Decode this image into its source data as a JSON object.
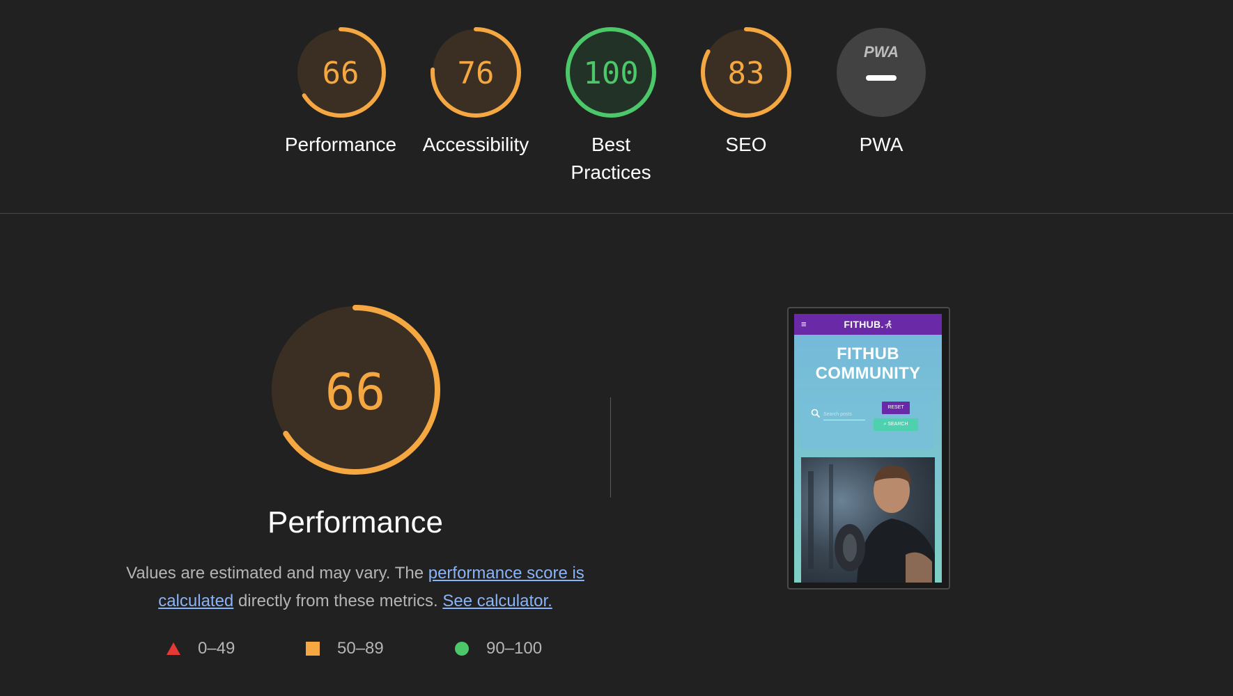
{
  "colors": {
    "average": "#f5a742",
    "average_bg": "#3a2f22",
    "pass": "#4cc76a",
    "pass_bg": "#223226",
    "fail": "#e53935",
    "na_bg": "#424242",
    "link": "#8ab4f8"
  },
  "gauges": [
    {
      "score": "66",
      "score_fraction": 0.66,
      "label": "Performance",
      "rating": "average"
    },
    {
      "score": "76",
      "score_fraction": 0.76,
      "label": "Accessibility",
      "rating": "average"
    },
    {
      "score": "100",
      "score_fraction": 1.0,
      "label_line1": "Best",
      "label_line2": "Practices",
      "rating": "pass"
    },
    {
      "score": "83",
      "score_fraction": 0.83,
      "label": "SEO",
      "rating": "average"
    },
    {
      "badge": "PWA",
      "label": "PWA",
      "rating": "not-applicable"
    }
  ],
  "performance": {
    "score": "66",
    "score_fraction": 0.66,
    "title": "Performance",
    "desc_prefix": "Values are estimated and may vary. The ",
    "desc_link": "performance score is calculated",
    "desc_middle": " directly from these metrics. ",
    "calc_link": "See calculator."
  },
  "legend": [
    {
      "icon": "triangle-icon",
      "range": "0–49",
      "color": "#e53935"
    },
    {
      "icon": "square-icon",
      "range": "50–89",
      "color": "#f5a742"
    },
    {
      "icon": "circle-icon",
      "range": "90–100",
      "color": "#4cc76a"
    }
  ],
  "screenshot": {
    "menu_icon": "≡",
    "brand": "FITHUB.",
    "hero_line1": "FITHUB",
    "hero_line2": "COMMUNITY",
    "search_placeholder": "Search posts",
    "reset_label": "RESET",
    "search_label": "SEARCH"
  }
}
